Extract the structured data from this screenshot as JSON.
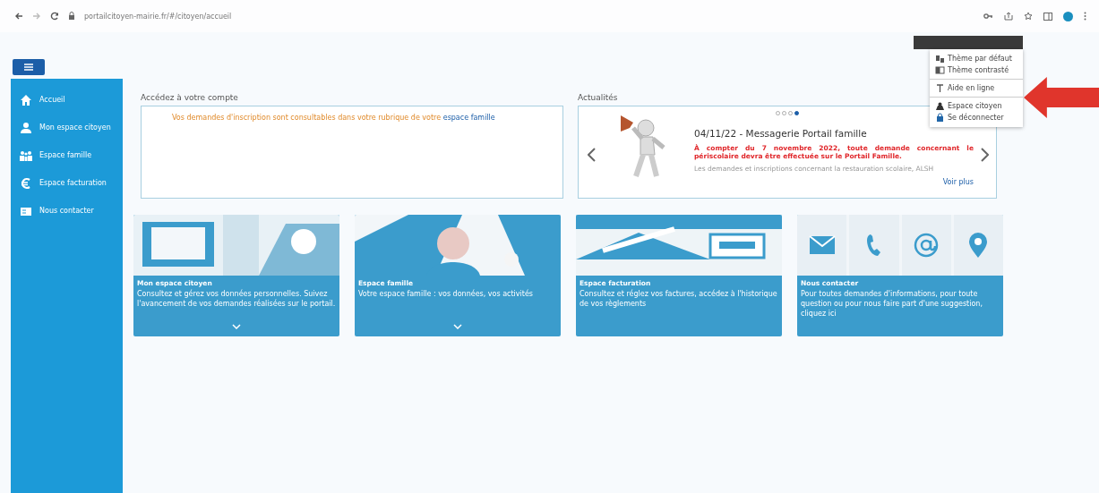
{
  "browser": {
    "url": "portailcitoyen-mairie.fr/#/citoyen/accueil"
  },
  "user_menu": {
    "groups": [
      [
        {
          "label": "Thème par défaut"
        },
        {
          "label": "Thème contrasté"
        }
      ],
      [
        {
          "label": "Aide en ligne"
        }
      ],
      [
        {
          "label": "Espace citoyen"
        },
        {
          "label": "Se déconnecter"
        }
      ]
    ]
  },
  "sidebar": {
    "items": [
      {
        "label": "Accueil",
        "selected": false
      },
      {
        "label": "Mon espace citoyen",
        "selected": false
      },
      {
        "label": "Espace famille",
        "selected": false
      },
      {
        "label": "Espace facturation",
        "selected": false
      },
      {
        "label": "Nous contacter",
        "selected": false
      }
    ]
  },
  "account": {
    "title": "Accédez à votre compte",
    "message": "Vos demandes d'inscription sont consultables dans votre rubrique de votre",
    "link": "espace famille"
  },
  "news": {
    "title": "Actualités",
    "dots": [
      {
        "selected": false
      },
      {
        "selected": false
      },
      {
        "selected": false
      },
      {
        "selected": true
      }
    ],
    "headline": "04/11/22 - Messagerie Portail famille",
    "alert": "À compter du 7 novembre 2022, toute demande concernant le périscolaire devra être effectuée sur le Portail Famille.",
    "summary": "Les demandes et inscriptions concernant la restauration scolaire, ALSH",
    "more": "Voir plus"
  },
  "cards": [
    {
      "kind": "picture",
      "title": "Mon espace citoyen",
      "text": "Consultez et gérez vos données personnelles. Suivez l'avancement de vos demandes réalisées sur le portail.",
      "expand": true
    },
    {
      "kind": "picture",
      "title": "Espace famille",
      "text": "Votre espace famille : vos données, vos activités",
      "expand": true
    },
    {
      "kind": "picture",
      "title": "Espace facturation",
      "text": "Consultez et réglez vos factures, accédez à l'historique de vos règlements",
      "expand": false
    },
    {
      "kind": "contact",
      "title": "Nous contacter",
      "text": "Pour toutes demandes d'informations, pour toute question ou pour nous faire part d'une suggestion, cliquez ici",
      "expand": false
    }
  ]
}
